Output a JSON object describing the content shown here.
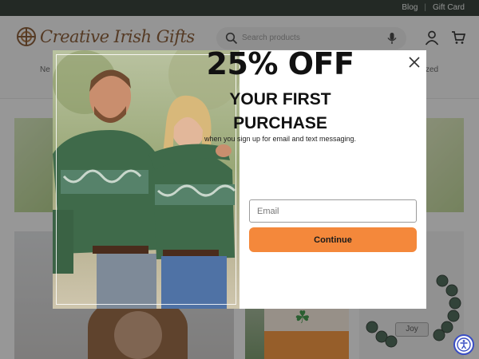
{
  "topbar": {
    "links": [
      "Blog",
      "Gift Card"
    ],
    "separator": "|"
  },
  "header": {
    "logo_text": "Creative Irish Gifts",
    "search_placeholder": "Search products",
    "nav_left_fragment": "Ne",
    "nav_right_fragment": "zed"
  },
  "background": {
    "bracelet_tag": "Joy"
  },
  "popup": {
    "headline": "25% OFF",
    "subheadline_line1": "YOUR FIRST",
    "subheadline_line2": "PURCHASE",
    "description": "when you sign up for email and text messaging.",
    "email_placeholder": "Email",
    "cta_label": "Continue"
  },
  "colors": {
    "topbar": "#1f2a24",
    "cta": "#f4883b",
    "sweater_green": "#3f6a4a",
    "accessibility_blue": "#3a4ec4"
  },
  "icons": [
    "celtic-knot-logo-icon",
    "search-icon",
    "microphone-icon",
    "account-icon",
    "cart-icon",
    "close-icon",
    "accessibility-icon"
  ]
}
